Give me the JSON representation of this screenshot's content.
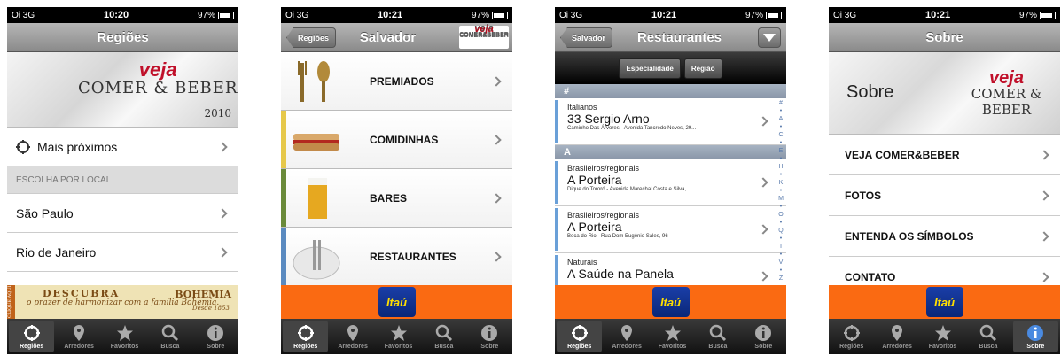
{
  "status": {
    "carrier": "Oi",
    "network": "3G",
    "battery": "97%"
  },
  "tabs": [
    "Regiões",
    "Arredores",
    "Favoritos",
    "Busca",
    "Sobre"
  ],
  "screen1": {
    "time": "10:20",
    "title": "Regiões",
    "banner": {
      "veja": "veja",
      "comer_beber": "COMER & BEBER",
      "year": "2010"
    },
    "nearby": "Mais próximos",
    "section": "ESCOLHA POR LOCAL",
    "places": [
      "São Paulo",
      "Rio de Janeiro"
    ],
    "ad": {
      "side": "CLIQUE AQUI",
      "line1": "DESCUBRA",
      "line2": "o prazer de harmonizar com a família Bohemia.",
      "brand": "BOHEMIA",
      "since": "Desde 1853"
    }
  },
  "screen2": {
    "time": "10:21",
    "back": "Regiões",
    "title": "Salvador",
    "categories": [
      "PREMIADOS",
      "COMIDINHAS",
      "BARES",
      "RESTAURANTES"
    ],
    "ad": "Itaú"
  },
  "screen3": {
    "time": "10:21",
    "back": "Salvador",
    "title": "Restaurantes",
    "segments": [
      "Especialidade",
      "Região"
    ],
    "sections": [
      "#",
      "A"
    ],
    "items": [
      {
        "cat": "Italianos",
        "name": "33 Sergio Arno",
        "addr": "Caminho Das Árvores - Avenida Tancredo Neves, 29..."
      },
      {
        "cat": "Brasileiros/regionais",
        "name": "A Porteira",
        "addr": "Dique do Tororó - Avenida Marechal Costa e Silva,..."
      },
      {
        "cat": "Brasileiros/regionais",
        "name": "A Porteira",
        "addr": "Boca do Rio - Rua Dom Eugênio Sales, 96"
      },
      {
        "cat": "Naturais",
        "name": "A Saúde na Panela",
        "addr": ""
      }
    ],
    "index": "#•A•C•E•H•K•M•O•Q•T•V•Z",
    "ad": "Itaú"
  },
  "screen4": {
    "time": "10:21",
    "title": "Sobre",
    "banner_text": "Sobre",
    "banner_logo": {
      "veja": "veja",
      "comer_beber": "COMER & BEBER"
    },
    "items": [
      "VEJA COMER&BEBER",
      "FOTOS",
      "ENTENDA OS SÍMBOLOS",
      "CONTATO"
    ],
    "ad": "Itaú"
  }
}
